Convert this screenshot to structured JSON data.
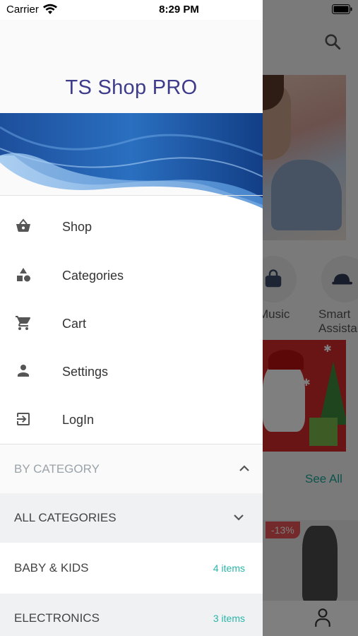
{
  "status_bar": {
    "carrier": "Carrier",
    "time": "8:29 PM"
  },
  "drawer": {
    "title": "TS Shop PRO",
    "menu": [
      {
        "label": "Shop",
        "icon": "basket-icon"
      },
      {
        "label": "Categories",
        "icon": "shapes-icon"
      },
      {
        "label": "Cart",
        "icon": "cart-icon"
      },
      {
        "label": "Settings",
        "icon": "person-icon"
      },
      {
        "label": "LogIn",
        "icon": "login-icon"
      }
    ],
    "by_category": {
      "label": "BY CATEGORY"
    },
    "categories": [
      {
        "label": "ALL CATEGORIES",
        "count": ""
      },
      {
        "label": "BABY & KIDS",
        "count": "4 items"
      },
      {
        "label": "ELECTRONICS",
        "count": "3 items"
      }
    ]
  },
  "background": {
    "categories": [
      "Music",
      "Smart Assistant"
    ],
    "see_all": "See All",
    "sale_badge": "-13%"
  },
  "colors": {
    "title": "#3e3b8a",
    "accent": "#2bb6a8",
    "sale": "#e85454"
  }
}
